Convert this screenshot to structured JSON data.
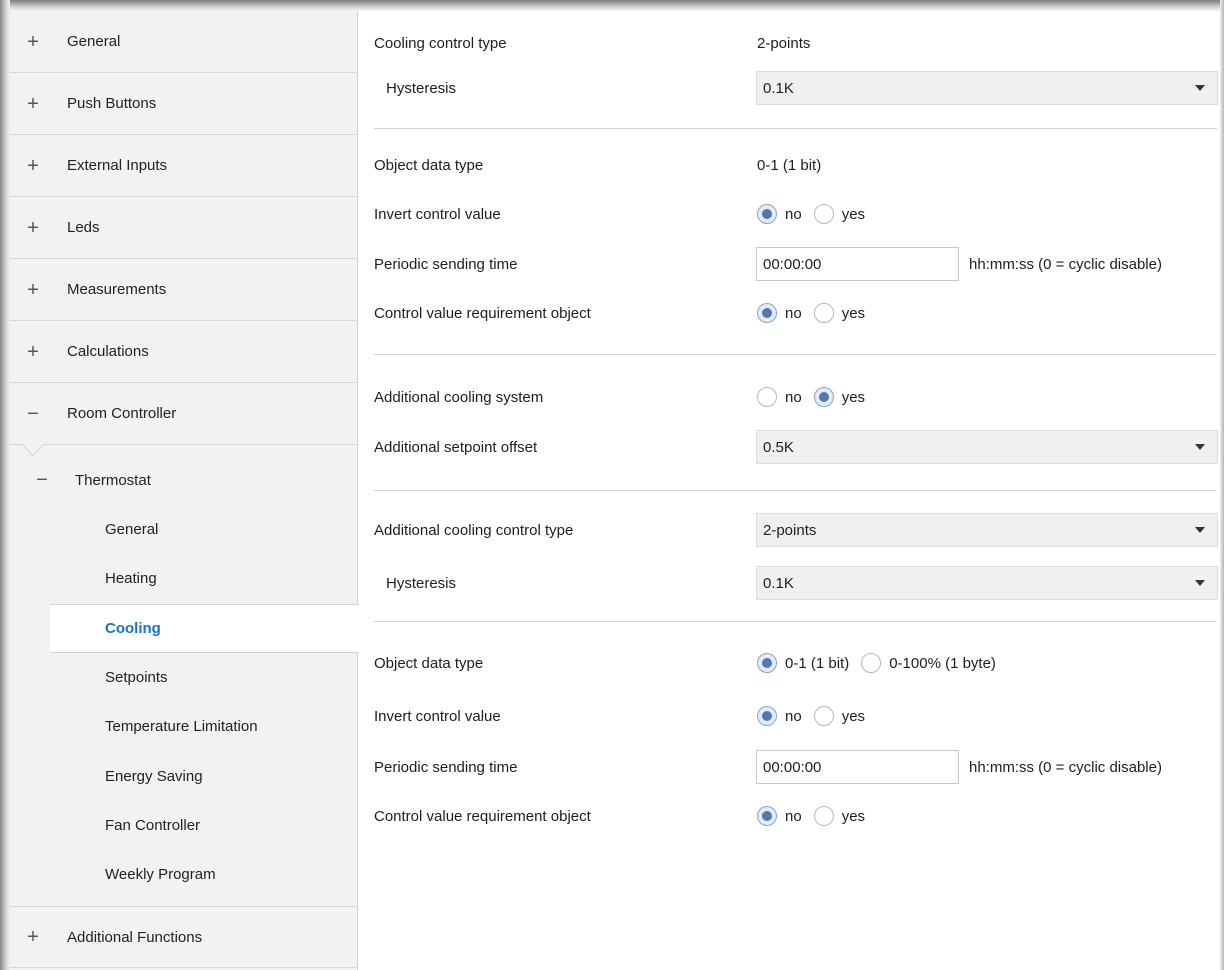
{
  "sidebar": {
    "top_items": [
      {
        "sign": "+",
        "label": "General"
      },
      {
        "sign": "+",
        "label": "Push Buttons"
      },
      {
        "sign": "+",
        "label": "External Inputs"
      },
      {
        "sign": "+",
        "label": "Leds"
      },
      {
        "sign": "+",
        "label": "Measurements"
      },
      {
        "sign": "+",
        "label": "Calculations"
      },
      {
        "sign": "−",
        "label": "Room Controller"
      }
    ],
    "thermostat": {
      "sign": "−",
      "label": "Thermostat"
    },
    "thermostat_items": [
      {
        "label": "General"
      },
      {
        "label": "Heating"
      },
      {
        "label": "Cooling",
        "active": true
      },
      {
        "label": "Setpoints"
      },
      {
        "label": "Temperature Limitation"
      },
      {
        "label": "Energy Saving"
      },
      {
        "label": "Fan Controller"
      },
      {
        "label": "Weekly Program"
      }
    ],
    "bottom_item": {
      "sign": "+",
      "label": "Additional Functions"
    }
  },
  "main": {
    "cooling_control_type": {
      "label": "Cooling control type",
      "value": "2-points"
    },
    "hysteresis_1": {
      "label": "Hysteresis",
      "value": "0.1K"
    },
    "object_data_type_1": {
      "label": "Object data type",
      "value": "0-1 (1 bit)"
    },
    "invert_control_value_1": {
      "label": "Invert control value",
      "options": [
        "no",
        "yes"
      ],
      "selected": "no"
    },
    "periodic_sending_time_1": {
      "label": "Periodic sending time",
      "value": "00:00:00",
      "unit": "hh:mm:ss (0 = cyclic disable)"
    },
    "control_value_requirement_1": {
      "label": "Control value requirement object",
      "options": [
        "no",
        "yes"
      ],
      "selected": "no"
    },
    "additional_cooling_system": {
      "label": "Additional cooling system",
      "options": [
        "no",
        "yes"
      ],
      "selected": "yes"
    },
    "additional_setpoint_offset": {
      "label": "Additional setpoint offset",
      "value": "0.5K"
    },
    "additional_cooling_control_type": {
      "label": "Additional cooling control type",
      "value": "2-points"
    },
    "hysteresis_2": {
      "label": "Hysteresis",
      "value": "0.1K"
    },
    "object_data_type_2": {
      "label": "Object data type",
      "options": [
        "0-1 (1 bit)",
        "0-100% (1 byte)"
      ],
      "selected": "0-1 (1 bit)"
    },
    "invert_control_value_2": {
      "label": "Invert control value",
      "options": [
        "no",
        "yes"
      ],
      "selected": "no"
    },
    "periodic_sending_time_2": {
      "label": "Periodic sending time",
      "value": "00:00:00",
      "unit": "hh:mm:ss (0 = cyclic disable)"
    },
    "control_value_requirement_2": {
      "label": "Control value requirement object",
      "options": [
        "no",
        "yes"
      ],
      "selected": "no"
    }
  },
  "colors": {
    "active_item": "#1a73c8",
    "radio_checked": "#4f79b3",
    "sidebar_bg": "#f2f2f2"
  }
}
